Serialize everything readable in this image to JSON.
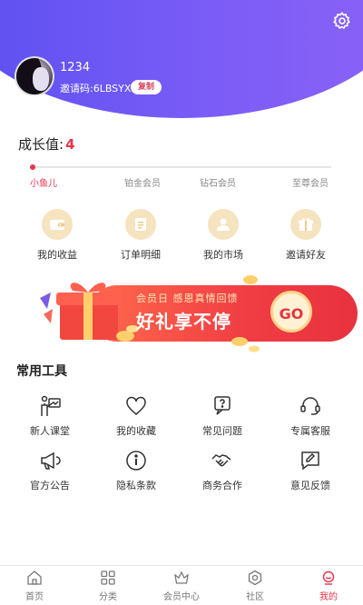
{
  "profile": {
    "username": "1234",
    "invite_code": "邀请码:6LBSYX",
    "copy_label": "复制"
  },
  "growth": {
    "label": "成长值:",
    "value": "4",
    "levels": [
      "小鱼儿",
      "铂金会员",
      "钻石会员",
      "至尊会员"
    ]
  },
  "quick_menu": [
    {
      "label": "我的收益",
      "icon": "wallet-icon"
    },
    {
      "label": "订单明细",
      "icon": "order-list-icon"
    },
    {
      "label": "我的市场",
      "icon": "market-user-icon"
    },
    {
      "label": "邀请好友",
      "icon": "gift-icon"
    }
  ],
  "banner": {
    "subtitle": "会员日 感恩真情回馈",
    "title": "好礼享不停",
    "go_label": "GO"
  },
  "tools": {
    "title": "常用工具",
    "items": [
      {
        "label": "新人课堂",
        "icon": "classroom-icon"
      },
      {
        "label": "我的收藏",
        "icon": "heart-icon"
      },
      {
        "label": "常见问题",
        "icon": "faq-icon"
      },
      {
        "label": "专属客服",
        "icon": "headset-icon"
      },
      {
        "label": "官方公告",
        "icon": "megaphone-icon"
      },
      {
        "label": "隐私条款",
        "icon": "info-icon"
      },
      {
        "label": "商务合作",
        "icon": "handshake-icon"
      },
      {
        "label": "意见反馈",
        "icon": "feedback-icon"
      }
    ]
  },
  "nav": [
    {
      "label": "首页",
      "icon": "home-icon"
    },
    {
      "label": "分类",
      "icon": "category-icon"
    },
    {
      "label": "会员中心",
      "icon": "crown-icon"
    },
    {
      "label": "社区",
      "icon": "community-icon"
    },
    {
      "label": "我的",
      "icon": "profile-icon"
    }
  ],
  "colors": {
    "header_start": "#5a4ff0",
    "header_end": "#8c63f7",
    "accent": "#e8334a",
    "quick_icon_bg": "#f6e3bf",
    "banner_red": "#f03c43"
  }
}
